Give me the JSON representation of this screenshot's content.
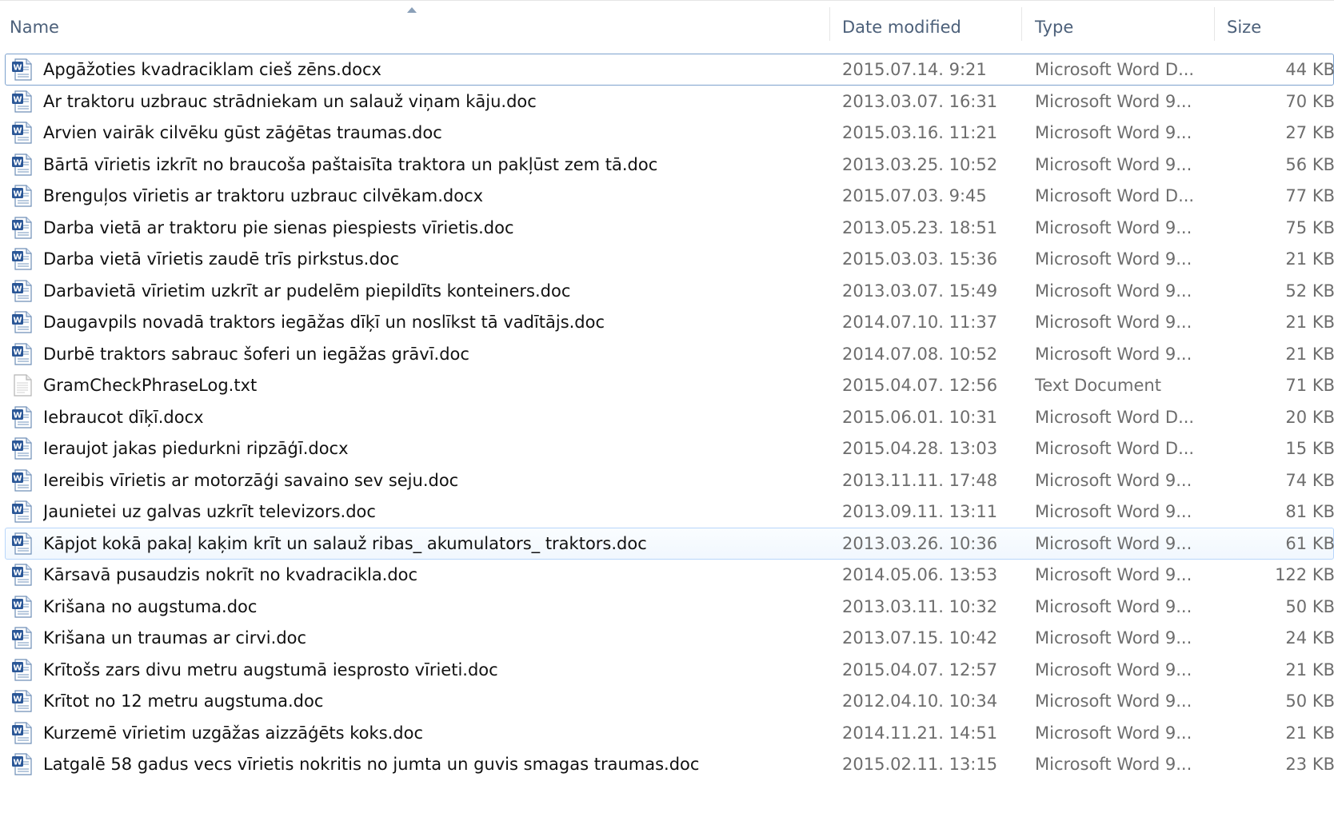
{
  "columns": {
    "name": "Name",
    "date": "Date modified",
    "type": "Type",
    "size": "Size"
  },
  "files": [
    {
      "name": "Apgāžoties kvadraciklam cieš zēns.docx",
      "date": "2015.07.14. 9:21",
      "type": "Microsoft Word D...",
      "size": "44 KB",
      "icon": "word-doc-icon"
    },
    {
      "name": "Ar traktoru uzbrauc strādniekam un salauž viņam kāju.doc",
      "date": "2013.03.07. 16:31",
      "type": "Microsoft Word 9...",
      "size": "70 KB",
      "icon": "word-doc-icon"
    },
    {
      "name": "Arvien vairāk cilvēku gūst zāģētas traumas.doc",
      "date": "2015.03.16. 11:21",
      "type": "Microsoft Word 9...",
      "size": "27 KB",
      "icon": "word-doc-icon"
    },
    {
      "name": "Bārtā vīrietis izkrīt no braucoša paštaisīta traktora un pakļūst zem tā.doc",
      "date": "2013.03.25. 10:52",
      "type": "Microsoft Word 9...",
      "size": "56 KB",
      "icon": "word-doc-icon"
    },
    {
      "name": "Brenguļos vīrietis ar traktoru uzbrauc cilvēkam.docx",
      "date": "2015.07.03. 9:45",
      "type": "Microsoft Word D...",
      "size": "77 KB",
      "icon": "word-doc-icon"
    },
    {
      "name": "Darba vietā ar traktoru pie sienas piespiests vīrietis.doc",
      "date": "2013.05.23. 18:51",
      "type": "Microsoft Word 9...",
      "size": "75 KB",
      "icon": "word-doc-icon"
    },
    {
      "name": "Darba vietā vīrietis zaudē trīs pirkstus.doc",
      "date": "2015.03.03. 15:36",
      "type": "Microsoft Word 9...",
      "size": "21 KB",
      "icon": "word-doc-icon"
    },
    {
      "name": "Darbavietā vīrietim uzkrīt ar pudelēm piepildīts konteiners.doc",
      "date": "2013.03.07. 15:49",
      "type": "Microsoft Word 9...",
      "size": "52 KB",
      "icon": "word-doc-icon"
    },
    {
      "name": "Daugavpils novadā traktors iegāžas dīķī un noslīkst tā vadītājs.doc",
      "date": "2014.07.10. 11:37",
      "type": "Microsoft Word 9...",
      "size": "21 KB",
      "icon": "word-doc-icon"
    },
    {
      "name": "Durbē traktors sabrauc šoferi un iegāžas grāvī.doc",
      "date": "2014.07.08. 10:52",
      "type": "Microsoft Word 9...",
      "size": "21 KB",
      "icon": "word-doc-icon"
    },
    {
      "name": "GramCheckPhraseLog.txt",
      "date": "2015.04.07. 12:56",
      "type": "Text Document",
      "size": "71 KB",
      "icon": "text-file-icon"
    },
    {
      "name": "Iebraucot dīķī.docx",
      "date": "2015.06.01. 10:31",
      "type": "Microsoft Word D...",
      "size": "20 KB",
      "icon": "word-doc-icon"
    },
    {
      "name": "Ieraujot jakas piedurkni ripzāģī.docx",
      "date": "2015.04.28. 13:03",
      "type": "Microsoft Word D...",
      "size": "15 KB",
      "icon": "word-doc-icon"
    },
    {
      "name": "Iereibis vīrietis ar motorzāģi savaino sev seju.doc",
      "date": "2013.11.11. 17:48",
      "type": "Microsoft Word 9...",
      "size": "74 KB",
      "icon": "word-doc-icon"
    },
    {
      "name": "Jaunietei uz galvas uzkrīt televizors.doc",
      "date": "2013.09.11. 13:11",
      "type": "Microsoft Word 9...",
      "size": "81 KB",
      "icon": "word-doc-icon"
    },
    {
      "name": "Kāpjot kokā pakaļ kaķim krīt un salauž ribas_ akumulators_ traktors.doc",
      "date": "2013.03.26. 10:36",
      "type": "Microsoft Word 9...",
      "size": "61 KB",
      "icon": "word-doc-icon"
    },
    {
      "name": "Kārsavā pusaudzis nokrīt no kvadracikla.doc",
      "date": "2014.05.06. 13:53",
      "type": "Microsoft Word 9...",
      "size": "122 KB",
      "icon": "word-doc-icon"
    },
    {
      "name": "Krišana no augstuma.doc",
      "date": "2013.03.11. 10:32",
      "type": "Microsoft Word 9...",
      "size": "50 KB",
      "icon": "word-doc-icon"
    },
    {
      "name": "Krišana un traumas ar cirvi.doc",
      "date": "2013.07.15. 10:42",
      "type": "Microsoft Word 9...",
      "size": "24 KB",
      "icon": "word-doc-icon"
    },
    {
      "name": "Krītošs zars divu metru augstumā iesprosto vīrieti.doc",
      "date": "2015.04.07. 12:57",
      "type": "Microsoft Word 9...",
      "size": "21 KB",
      "icon": "word-doc-icon"
    },
    {
      "name": "Krītot no 12 metru augstuma.doc",
      "date": "2012.04.10. 10:34",
      "type": "Microsoft Word 9...",
      "size": "50 KB",
      "icon": "word-doc-icon"
    },
    {
      "name": "Kurzemē vīrietim uzgāžas aizzāģēts koks.doc",
      "date": "2014.11.21. 14:51",
      "type": "Microsoft Word 9...",
      "size": "21 KB",
      "icon": "word-doc-icon"
    },
    {
      "name": "Latgalē 58 gadus vecs vīrietis nokritis no jumta un guvis smagas traumas.doc",
      "date": "2015.02.11. 13:15",
      "type": "Microsoft Word 9...",
      "size": "23 KB",
      "icon": "word-doc-icon"
    }
  ],
  "state": {
    "focused_index": 0,
    "hover_index": 15
  }
}
